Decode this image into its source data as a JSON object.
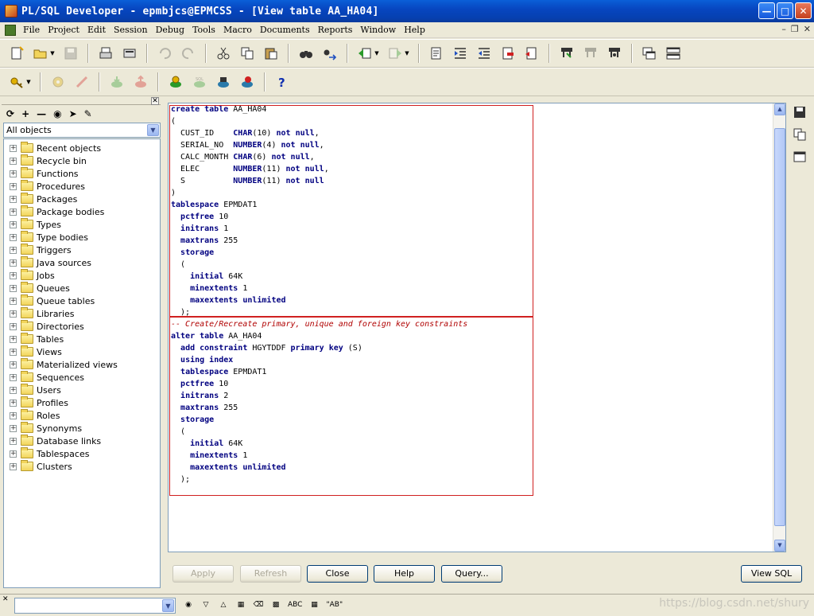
{
  "window": {
    "title": "PL/SQL Developer - epmbjcs@EPMCSS - [View table AA_HA04]"
  },
  "menu": [
    "File",
    "Project",
    "Edit",
    "Session",
    "Debug",
    "Tools",
    "Macro",
    "Documents",
    "Reports",
    "Window",
    "Help"
  ],
  "object_browser": {
    "filter_value": "All objects",
    "items": [
      "Recent objects",
      "Recycle bin",
      "Functions",
      "Procedures",
      "Packages",
      "Package bodies",
      "Types",
      "Type bodies",
      "Triggers",
      "Java sources",
      "Jobs",
      "Queues",
      "Queue tables",
      "Libraries",
      "Directories",
      "Tables",
      "Views",
      "Materialized views",
      "Sequences",
      "Users",
      "Profiles",
      "Roles",
      "Synonyms",
      "Database links",
      "Tablespaces",
      "Clusters"
    ]
  },
  "buttons": {
    "apply": "Apply",
    "refresh": "Refresh",
    "close": "Close",
    "help": "Help",
    "query": "Query...",
    "view_sql": "View SQL"
  },
  "find_bar": {
    "text": "",
    "abc": "ABC",
    "quote_ab": "\"AB\""
  },
  "watermark": "https://blog.csdn.net/shury"
}
